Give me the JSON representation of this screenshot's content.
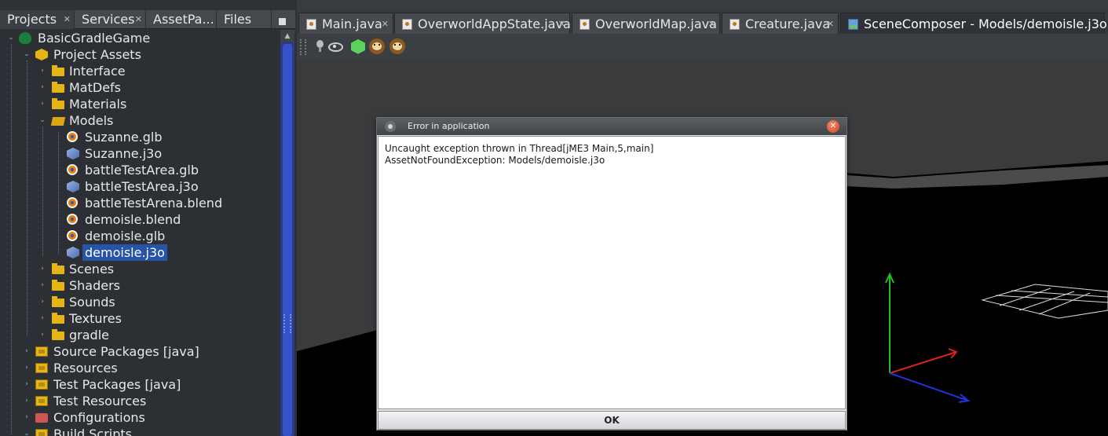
{
  "projects_panel": {
    "tabs": [
      {
        "label": "Projects",
        "close": "✕"
      },
      {
        "label": "Services",
        "close": "✕"
      },
      {
        "label": "AssetPa...",
        "close": "✕"
      },
      {
        "label": "Files",
        "close": ""
      }
    ],
    "tree": {
      "root": {
        "label": "BasicGradleGame",
        "icon": "project-icon"
      },
      "project_assets": {
        "label": "Project Assets",
        "icon": "assets-icon"
      },
      "folders_before_models": [
        {
          "label": "Interface",
          "icon": "folder-icon"
        },
        {
          "label": "MatDefs",
          "icon": "folder-icon"
        },
        {
          "label": "Materials",
          "icon": "folder-icon"
        }
      ],
      "models": {
        "label": "Models",
        "icon": "open-folder-icon"
      },
      "model_files": [
        {
          "label": "Suzanne.glb",
          "icon": "blender-icon"
        },
        {
          "label": "Suzanne.j3o",
          "icon": "j3o-icon"
        },
        {
          "label": "battleTestArea.glb",
          "icon": "blender-icon"
        },
        {
          "label": "battleTestArea.j3o",
          "icon": "j3o-icon"
        },
        {
          "label": "battleTestArena.blend",
          "icon": "blender-icon"
        },
        {
          "label": "demoisle.blend",
          "icon": "blender-icon"
        },
        {
          "label": "demoisle.glb",
          "icon": "blender-icon"
        },
        {
          "label": "demoisle.j3o",
          "icon": "j3o-icon",
          "selected": true
        }
      ],
      "folders_after_models": [
        {
          "label": "Scenes",
          "icon": "folder-icon"
        },
        {
          "label": "Shaders",
          "icon": "folder-icon"
        },
        {
          "label": "Sounds",
          "icon": "folder-icon"
        },
        {
          "label": "Textures",
          "icon": "folder-icon"
        },
        {
          "label": "gradle",
          "icon": "folder-icon"
        }
      ],
      "project_nodes": [
        {
          "label": "Source Packages [java]",
          "icon": "package-icon"
        },
        {
          "label": "Resources",
          "icon": "package-icon"
        },
        {
          "label": "Test Packages [java]",
          "icon": "package-icon"
        },
        {
          "label": "Test Resources",
          "icon": "package-icon"
        },
        {
          "label": "Configurations",
          "icon": "config-icon"
        },
        {
          "label": "Build Scripts",
          "icon": "package-icon"
        }
      ]
    }
  },
  "editor": {
    "tabs": [
      {
        "label": "Main.java",
        "close": "✕"
      },
      {
        "label": "OverworldAppState.java",
        "close": "✕"
      },
      {
        "label": "OverworldMap.java",
        "close": "✕"
      },
      {
        "label": "Creature.java",
        "close": "✕"
      },
      {
        "label": "SceneComposer - Models/demoisle.j3o",
        "close": ""
      }
    ],
    "toolbar_icons": [
      "bulb-icon",
      "eye-icon",
      "cube-icon",
      "monkey-icon",
      "monkey-icon"
    ]
  },
  "dialog": {
    "title": "Error in application",
    "message": "Uncaught exception thrown in Thread[jME3 Main,5,main]\nAssetNotFoundException: Models/demoisle.j3o",
    "ok_label": "OK",
    "close_symbol": "✕"
  },
  "colors": {
    "selection": "#2753a9",
    "panel_bg": "#2c2f33",
    "axis_x": "#e02020",
    "axis_y": "#22c022",
    "axis_z": "#2233e0"
  }
}
